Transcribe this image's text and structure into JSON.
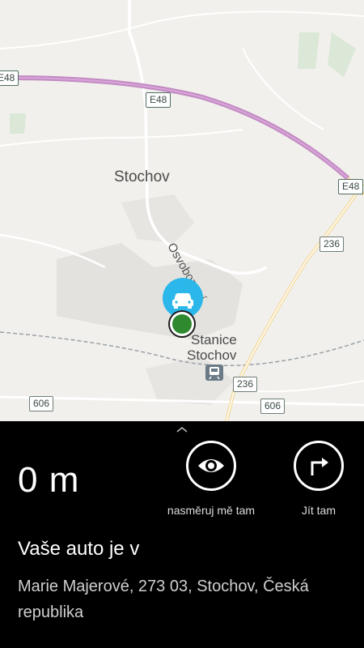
{
  "map": {
    "places": {
      "town": "Stochov",
      "station_line1": "Stanice",
      "station_line2": "Stochov"
    },
    "street": "Osvobození",
    "shields": {
      "e48_left": "E48",
      "e48_mid": "E48",
      "e48_right": "E48",
      "r236_top": "236",
      "r236_bottom": "236",
      "r606_left": "606",
      "r606_right": "606"
    },
    "icons": {
      "car_pin": "car-icon",
      "my_location": "location-dot-icon",
      "station": "train-station-icon"
    },
    "colors": {
      "background": "#f1f0ec",
      "motorway": "#c38ac4",
      "car_pin": "#2cb7ea",
      "my_location": "#2f8a2f"
    }
  },
  "panel": {
    "distance": "0 m",
    "actions": [
      {
        "label": "nasměruj mě tam",
        "icon": "eye-icon"
      },
      {
        "label": "Jít tam",
        "icon": "turn-right-arrow-icon"
      }
    ],
    "title": "Vaše auto je v",
    "address": "Marie Majerové, 273 03, Stochov, Česká republika"
  }
}
